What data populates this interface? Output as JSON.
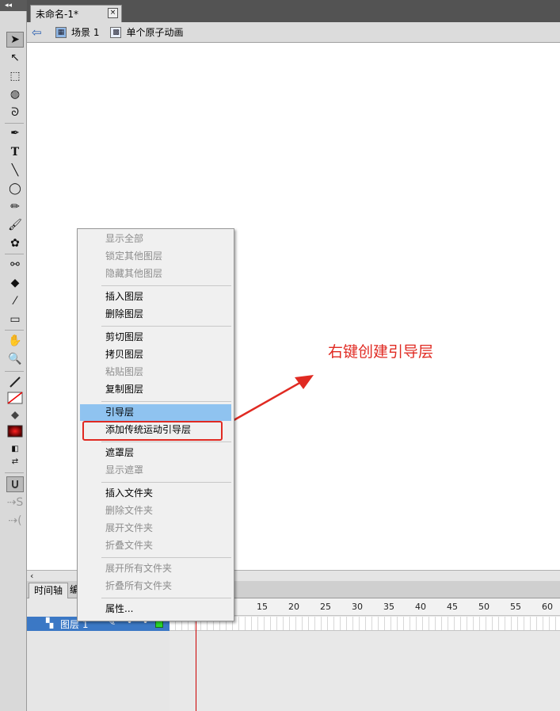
{
  "document": {
    "tab_title": "未命名-1*",
    "tab_close": "×"
  },
  "editbar": {
    "scene_label": "场景 1",
    "symbol_label": "单个原子动画"
  },
  "toolbar": {
    "grip": "◂◂",
    "tools": [
      {
        "name": "selection",
        "glyph": "➤"
      },
      {
        "name": "subselection",
        "glyph": "↖"
      },
      {
        "name": "free-transform",
        "glyph": "⬚"
      },
      {
        "name": "3d-rotation",
        "glyph": "◍"
      },
      {
        "name": "lasso",
        "glyph": "ᘐ"
      },
      {
        "name": "pen",
        "glyph": "✒"
      },
      {
        "name": "text",
        "glyph": "T"
      },
      {
        "name": "line",
        "glyph": "╲"
      },
      {
        "name": "oval",
        "glyph": "◯"
      },
      {
        "name": "pencil",
        "glyph": "✏"
      },
      {
        "name": "brush",
        "glyph": "🖌"
      },
      {
        "name": "deco",
        "glyph": "✿"
      },
      {
        "name": "bone",
        "glyph": "⚯"
      },
      {
        "name": "paint-bucket",
        "glyph": "◆"
      },
      {
        "name": "eyedropper",
        "glyph": "⁄"
      },
      {
        "name": "eraser",
        "glyph": "▭"
      },
      {
        "name": "hand",
        "glyph": "✋"
      },
      {
        "name": "zoom",
        "glyph": "🔍"
      }
    ]
  },
  "context_menu": {
    "items": [
      {
        "label": "显示全部",
        "enabled": false
      },
      {
        "label": "锁定其他图层",
        "enabled": false
      },
      {
        "label": "隐藏其他图层",
        "enabled": false
      },
      {
        "label": "插入图层",
        "enabled": true
      },
      {
        "label": "删除图层",
        "enabled": true
      },
      {
        "label": "剪切图层",
        "enabled": true
      },
      {
        "label": "拷贝图层",
        "enabled": true
      },
      {
        "label": "粘贴图层",
        "enabled": false
      },
      {
        "label": "复制图层",
        "enabled": true
      },
      {
        "label": "引导层",
        "enabled": true,
        "highlighted": true
      },
      {
        "label": "添加传统运动引导层",
        "enabled": true
      },
      {
        "label": "遮罩层",
        "enabled": true
      },
      {
        "label": "显示遮罩",
        "enabled": false
      },
      {
        "label": "插入文件夹",
        "enabled": true
      },
      {
        "label": "删除文件夹",
        "enabled": false
      },
      {
        "label": "展开文件夹",
        "enabled": false
      },
      {
        "label": "折叠文件夹",
        "enabled": false
      },
      {
        "label": "展开所有文件夹",
        "enabled": false
      },
      {
        "label": "折叠所有文件夹",
        "enabled": false
      },
      {
        "label": "属性...",
        "enabled": true
      }
    ]
  },
  "annotation": {
    "text": "右键创建引导层",
    "color": "#e02a22"
  },
  "timeline": {
    "tab_label": "时间轴",
    "tab2_label": "编",
    "ruler_ticks": [
      "15",
      "20",
      "25",
      "30",
      "35",
      "40",
      "45",
      "50",
      "55",
      "60"
    ],
    "layer_name": "图层 1"
  },
  "colors": {
    "highlight": "#8fc3f0",
    "layer_row": "#3b78c5",
    "playhead": "#cc0000"
  }
}
